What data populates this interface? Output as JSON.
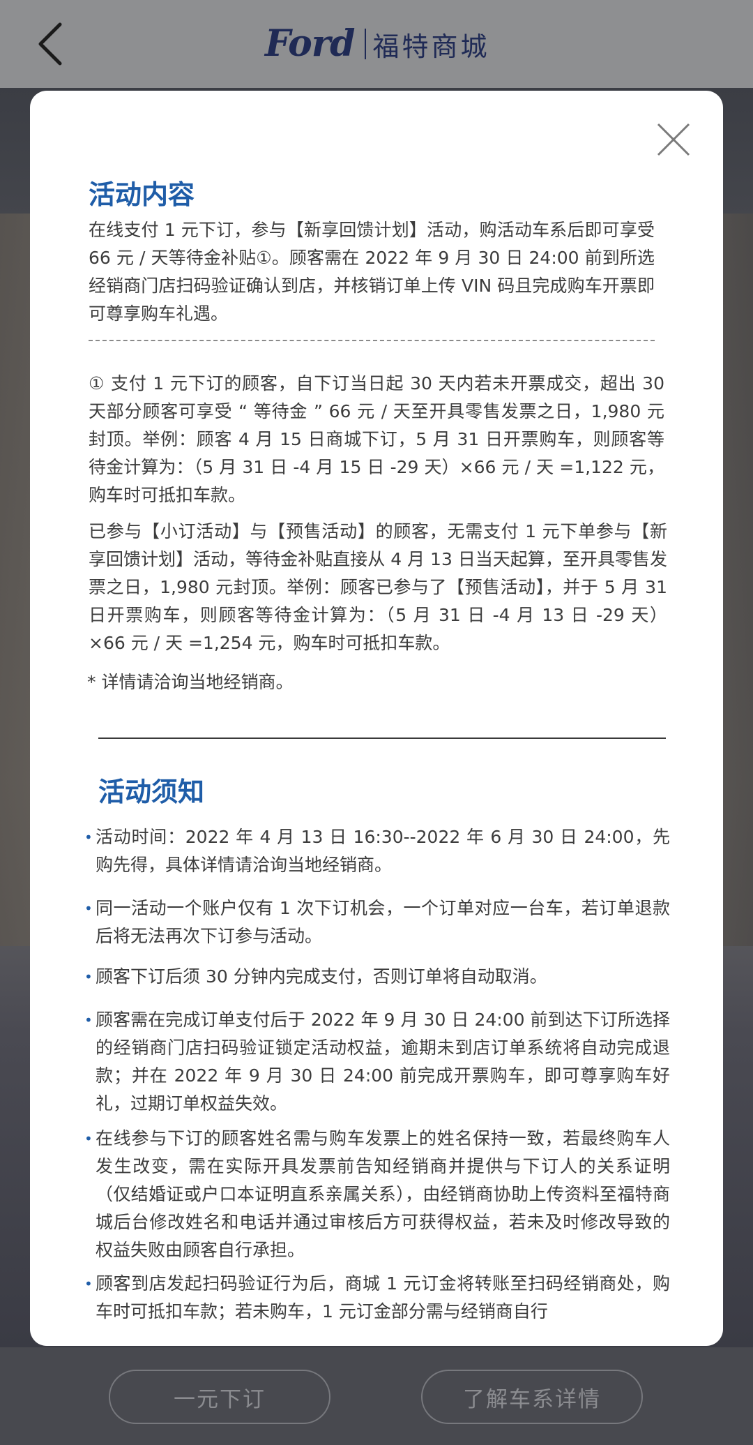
{
  "header": {
    "brand_logo": "Ford",
    "brand_title": "福特商城"
  },
  "modal": {
    "section1": {
      "title": "活动内容",
      "intro": "在线支付 1 元下订，参与【新享回馈计划】活动，购活动车系后即可享受 66 元 / 天等待金补贴①。顾客需在 2022 年 9 月 30 日 24:00 前到所选经销商门店扫码验证确认到店，并核销订单上传 VIN 码且完成购车开票即可尊享购车礼遇。",
      "note1": "① 支付 1 元下订的顾客，自下订当日起 30 天内若未开票成交，超出 30 天部分顾客可享受 “ 等待金 ” 66 元 / 天至开具零售发票之日，1,980 元封顶。举例：顾客 4 月 15 日商城下订，5 月 31 日开票购车，则顾客等待金计算为：（5 月 31 日 -4 月 15 日 -29 天）×66 元 / 天 =1,122 元，购车时可抵扣车款。",
      "note2": "已参与【小订活动】与【预售活动】的顾客，无需支付 1 元下单参与【新享回馈计划】活动，等待金补贴直接从 4 月 13 日当天起算，至开具零售发票之日，1,980 元封顶。举例：顾客已参与了【预售活动】，并于 5 月 31 日开票购车，则顾客等待金计算为：（5 月 31 日 -4 月 13 日 -29 天）×66 元 / 天 =1,254 元，购车时可抵扣车款。",
      "note3": "* 详情请洽询当地经销商。"
    },
    "section2": {
      "title": "活动须知",
      "items": [
        "活动时间：2022 年 4 月 13 日 16:30--2022 年 6 月 30 日 24:00，先购先得，具体详情请洽询当地经销商。",
        "同一活动一个账户仅有 1 次下订机会，一个订单对应一台车，若订单退款后将无法再次下订参与活动。",
        "顾客下订后须 30 分钟内完成支付，否则订单将自动取消。",
        "顾客需在完成订单支付后于 2022 年 9 月 30 日 24:00 前到达下订所选择的经销商门店扫码验证锁定活动权益，逾期未到店订单系统将自动完成退款；并在 2022 年 9 月 30 日 24:00 前完成开票购车，即可尊享购车好礼，过期订单权益失效。",
        "在线参与下订的顾客姓名需与购车发票上的姓名保持一致，若最终购车人发生改变，需在实际开具发票前告知经销商并提供与下订人的关系证明（仅结婚证或户口本证明直系亲属关系），由经销商协助上传资料至福特商城后台修改姓名和电话并通过审核后方可获得权益，若未及时修改导致的权益失败由顾客自行承担。",
        "顾客到店发起扫码验证行为后，商城 1 元订金将转账至扫码经销商处，购车时可抵扣车款；若未购车，1 元订金部分需与经销商自行"
      ]
    }
  },
  "bottom": {
    "order_button": "一元下订",
    "details_button": "了解车系详情"
  }
}
